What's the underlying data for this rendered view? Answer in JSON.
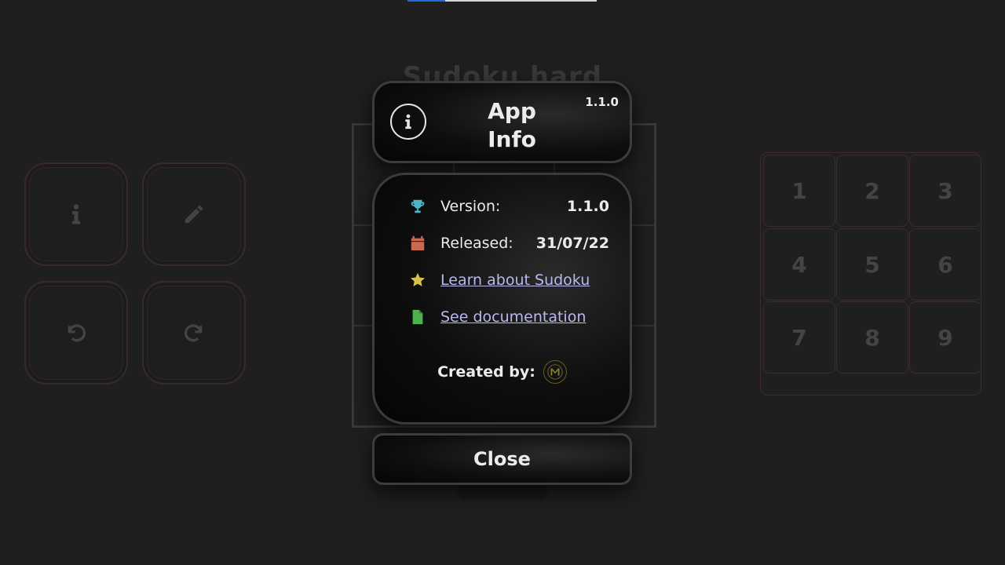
{
  "background": {
    "progress_fraction": 0.2,
    "title": "Sudoku hard",
    "numpad_keys": [
      "1",
      "2",
      "3",
      "4",
      "5",
      "6",
      "7",
      "8",
      "9"
    ],
    "tools": [
      {
        "name": "info-button",
        "icon": "info-icon"
      },
      {
        "name": "pencil-button",
        "icon": "pencil-icon"
      },
      {
        "name": "undo-button",
        "icon": "undo-icon"
      },
      {
        "name": "redo-button",
        "icon": "redo-icon"
      }
    ]
  },
  "modal": {
    "title": "App\nInfo",
    "version_badge": "1.1.0",
    "rows": {
      "version_label": "Version:",
      "version_value": "1.1.0",
      "released_label": "Released:",
      "released_value": "31/07/22",
      "learn_link": "Learn about Sudoku",
      "docs_link": "See documentation"
    },
    "created_by_label": "Created by:",
    "close_label": "Close"
  },
  "colors": {
    "trophy": "#4fb6c8",
    "calendar": "#c9684f",
    "star": "#d8c04a",
    "document": "#4bb34b",
    "link": "#b9b9f0",
    "accent_blue": "#1d6fd6"
  }
}
